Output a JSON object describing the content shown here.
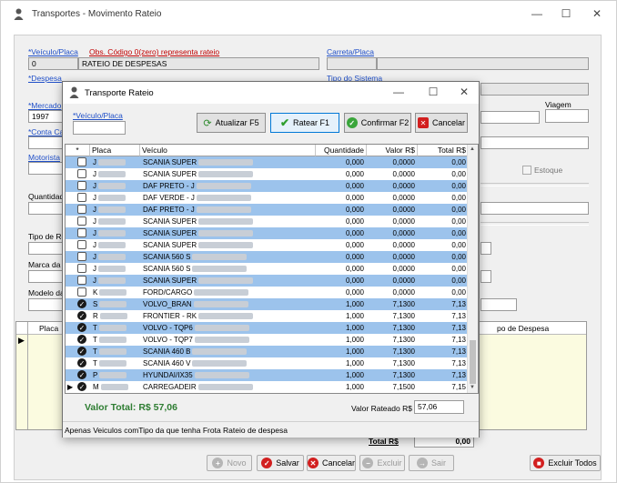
{
  "main": {
    "title": "Transportes - Movimento Rateio",
    "labels": {
      "veiculo_placa": "*Veículo/Placa",
      "obs": "Obs. Código 0(zero) representa rateio",
      "carreta_placa": "Carreta/Placa",
      "despesa": "*Despesa",
      "tipo_sistema": "Tipo do Sistema",
      "mercadoria": "*Mercado",
      "viagem": "Viagem",
      "conta_car": "*Conta Car",
      "motorista": "Motorista",
      "estoque": "Estoque",
      "quantidade": "Quantidad",
      "tipo_re": "Tipo de Re",
      "marca": "Marca da F",
      "modelo": "Modelo da",
      "grid_placa": "Placa",
      "grid_tipo_despesa": "po de Despesa",
      "total": "Total R$",
      "total_value": "0,00"
    },
    "fields": {
      "veiculo_code": "0",
      "veiculo_desc": "RATEIO DE DESPESAS",
      "mercadoria_code": "1997"
    },
    "buttons": {
      "novo": "Novo",
      "salvar": "Salvar",
      "cancelar": "Cancelar",
      "excluir": "Excluir",
      "sair": "Sair",
      "excluir_todos": "Excluir Todos"
    }
  },
  "dialog": {
    "title": "Transporte Rateio",
    "veiculo_label": "*Veículo/Placa",
    "buttons": {
      "atualizar": "Atualizar F5",
      "ratear": "Ratear F1",
      "confirmar": "Confirmar F2",
      "cancelar": "Cancelar"
    },
    "columns": [
      "*",
      "Placa",
      "Veículo",
      "Quantidade",
      "Valor R$",
      "Total R$"
    ],
    "rows": [
      {
        "checked": false,
        "placa": "J",
        "veiculo": "SCANIA SUPER",
        "quantidade": "0,000",
        "valor": "0,0000",
        "total": "0,00",
        "style": "blue"
      },
      {
        "checked": false,
        "placa": "J",
        "veiculo": "SCANIA SUPER",
        "quantidade": "0,000",
        "valor": "0,0000",
        "total": "0,00",
        "style": "white"
      },
      {
        "checked": false,
        "placa": "J",
        "veiculo": "DAF PRETO - J",
        "quantidade": "0,000",
        "valor": "0,0000",
        "total": "0,00",
        "style": "blue"
      },
      {
        "checked": false,
        "placa": "J",
        "veiculo": "DAF VERDE - J",
        "quantidade": "0,000",
        "valor": "0,0000",
        "total": "0,00",
        "style": "white"
      },
      {
        "checked": false,
        "placa": "J",
        "veiculo": "DAF PRETO - J",
        "quantidade": "0,000",
        "valor": "0,0000",
        "total": "0,00",
        "style": "blue"
      },
      {
        "checked": false,
        "placa": "J",
        "veiculo": "SCANIA SUPER",
        "quantidade": "0,000",
        "valor": "0,0000",
        "total": "0,00",
        "style": "white"
      },
      {
        "checked": false,
        "placa": "J",
        "veiculo": "SCANIA SUPER",
        "quantidade": "0,000",
        "valor": "0,0000",
        "total": "0,00",
        "style": "blue"
      },
      {
        "checked": false,
        "placa": "J",
        "veiculo": "SCANIA SUPER",
        "quantidade": "0,000",
        "valor": "0,0000",
        "total": "0,00",
        "style": "white"
      },
      {
        "checked": false,
        "placa": "J",
        "veiculo": "SCANIA 560 S",
        "quantidade": "0,000",
        "valor": "0,0000",
        "total": "0,00",
        "style": "blue"
      },
      {
        "checked": false,
        "placa": "J",
        "veiculo": "SCANIA 560 S",
        "quantidade": "0,000",
        "valor": "0,0000",
        "total": "0,00",
        "style": "white"
      },
      {
        "checked": false,
        "placa": "J",
        "veiculo": "SCANIA SUPER",
        "quantidade": "0,000",
        "valor": "0,0000",
        "total": "0,00",
        "style": "blue"
      },
      {
        "checked": false,
        "placa": "K",
        "veiculo": "FORD/CARGO",
        "quantidade": "0,000",
        "valor": "0,0000",
        "total": "0,00",
        "style": "white"
      },
      {
        "checked": true,
        "placa": "S",
        "veiculo": "VOLVO_BRAN",
        "quantidade": "1,000",
        "valor": "7,1300",
        "total": "7,13",
        "style": "blue"
      },
      {
        "checked": true,
        "placa": "R",
        "veiculo": "FRONTIER - RK",
        "quantidade": "1,000",
        "valor": "7,1300",
        "total": "7,13",
        "style": "white"
      },
      {
        "checked": true,
        "placa": "T",
        "veiculo": "VOLVO - TQP6",
        "quantidade": "1,000",
        "valor": "7,1300",
        "total": "7,13",
        "style": "blue"
      },
      {
        "checked": true,
        "placa": "T",
        "veiculo": "VOLVO - TQP7",
        "quantidade": "1,000",
        "valor": "7,1300",
        "total": "7,13",
        "style": "white"
      },
      {
        "checked": true,
        "placa": "T",
        "veiculo": "SCANIA 460 B",
        "quantidade": "1,000",
        "valor": "7,1300",
        "total": "7,13",
        "style": "blue"
      },
      {
        "checked": true,
        "placa": "T",
        "veiculo": "SCANIA 460 V",
        "quantidade": "1,000",
        "valor": "7,1300",
        "total": "7,13",
        "style": "white"
      },
      {
        "checked": true,
        "placa": "P",
        "veiculo": "HYUNDAI/IX35",
        "quantidade": "1,000",
        "valor": "7,1300",
        "total": "7,13",
        "style": "blue"
      },
      {
        "checked": true,
        "placa": "M",
        "veiculo": "CARREGADEIR",
        "quantidade": "1,000",
        "valor": "7,1500",
        "total": "7,15",
        "style": "white"
      }
    ],
    "valor_total": "Valor Total: R$ 57,06",
    "valor_rateado_label": "Valor Rateado R$",
    "valor_rateado": "57,06",
    "status": "Apenas Veiculos comTipo da que tenha Frota Rateio de despesa"
  }
}
